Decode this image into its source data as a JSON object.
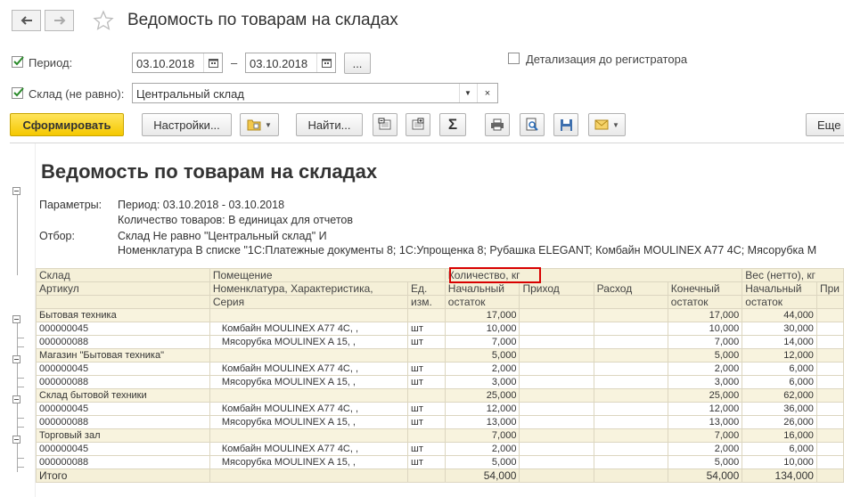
{
  "window": {
    "title": "Ведомость по товарам на складах"
  },
  "toolbar_top": {
    "back": "back",
    "forward": "forward"
  },
  "period": {
    "label": "Период:",
    "from": "03.10.2018",
    "dash": "–",
    "to": "03.10.2018",
    "more": "..."
  },
  "detail": {
    "label": "Детализация до регистратора"
  },
  "warehouse_filter": {
    "label": "Склад (не равно):",
    "value": "Центральный склад"
  },
  "buttons": {
    "generate": "Сформировать",
    "settings": "Настройки...",
    "find": "Найти...",
    "sum": "Σ",
    "more": "Еще"
  },
  "report": {
    "title": "Ведомость по товарам на складах",
    "params_label": "Параметры:",
    "params_line1": "Период: 03.10.2018 - 03.10.2018",
    "params_line2": "Количество товаров: В единицах для отчетов",
    "filter_label": "Отбор:",
    "filter_line1": "Склад Не равно \"Центральный склад\" И",
    "filter_line2": "Номенклатура В списке \"1С:Платежные документы 8; 1С:Упрощенка 8; Рубашка ELEGANT; Комбайн MOULINEX  A77 4C; Мясорубка M"
  },
  "table": {
    "h1": {
      "warehouse": "Склад",
      "room": "Помещение",
      "qty": "Количество, кг",
      "weight": "Вес (нетто), кг"
    },
    "h2": {
      "article": "Артикул",
      "nomenclature": "Номенклатура, Характеристика,",
      "unit": "Ед.",
      "start": "Начальный",
      "income": "Приход",
      "outcome": "Расход",
      "end": "Конечный",
      "start2": "Начальный",
      "income2": "При"
    },
    "h3": {
      "series": "Серия",
      "unit2": "изм.",
      "start": "остаток",
      "end": "остаток",
      "start2": "остаток"
    },
    "rows": [
      {
        "type": "group",
        "name": "Бытовая техника",
        "qty_start": "17,000",
        "qty_end": "17,000",
        "w_start": "44,000"
      },
      {
        "type": "item",
        "article": "000000045",
        "name": "Комбайн MOULINEX  A77 4C, ,",
        "unit": "шт",
        "qty_start": "10,000",
        "qty_end": "10,000",
        "w_start": "30,000"
      },
      {
        "type": "item",
        "article": "000000088",
        "name": "Мясорубка MOULINEX  A 15, ,",
        "unit": "шт",
        "qty_start": "7,000",
        "qty_end": "7,000",
        "w_start": "14,000"
      },
      {
        "type": "group",
        "name": "Магазин \"Бытовая техника\"",
        "qty_start": "5,000",
        "qty_end": "5,000",
        "w_start": "12,000"
      },
      {
        "type": "item",
        "article": "000000045",
        "name": "Комбайн MOULINEX  A77 4C, ,",
        "unit": "шт",
        "qty_start": "2,000",
        "qty_end": "2,000",
        "w_start": "6,000"
      },
      {
        "type": "item",
        "article": "000000088",
        "name": "Мясорубка MOULINEX  A 15, ,",
        "unit": "шт",
        "qty_start": "3,000",
        "qty_end": "3,000",
        "w_start": "6,000"
      },
      {
        "type": "group",
        "name": "Склад бытовой техники",
        "qty_start": "25,000",
        "qty_end": "25,000",
        "w_start": "62,000"
      },
      {
        "type": "item",
        "article": "000000045",
        "name": "Комбайн MOULINEX  A77 4C, ,",
        "unit": "шт",
        "qty_start": "12,000",
        "qty_end": "12,000",
        "w_start": "36,000"
      },
      {
        "type": "item",
        "article": "000000088",
        "name": "Мясорубка MOULINEX  A 15, ,",
        "unit": "шт",
        "qty_start": "13,000",
        "qty_end": "13,000",
        "w_start": "26,000"
      },
      {
        "type": "group",
        "name": "Торговый зал",
        "qty_start": "7,000",
        "qty_end": "7,000",
        "w_start": "16,000"
      },
      {
        "type": "item",
        "article": "000000045",
        "name": "Комбайн MOULINEX  A77 4C, ,",
        "unit": "шт",
        "qty_start": "2,000",
        "qty_end": "2,000",
        "w_start": "6,000"
      },
      {
        "type": "item",
        "article": "000000088",
        "name": "Мясорубка MOULINEX  A 15, ,",
        "unit": "шт",
        "qty_start": "5,000",
        "qty_end": "5,000",
        "w_start": "10,000"
      }
    ],
    "total": {
      "label": "Итого",
      "qty_start": "54,000",
      "qty_end": "54,000",
      "w_start": "134,000"
    }
  },
  "colors": {
    "accent_yellow": "#f5c800",
    "highlight_red": "#d80000",
    "header_bg": "#f5f0d8"
  }
}
